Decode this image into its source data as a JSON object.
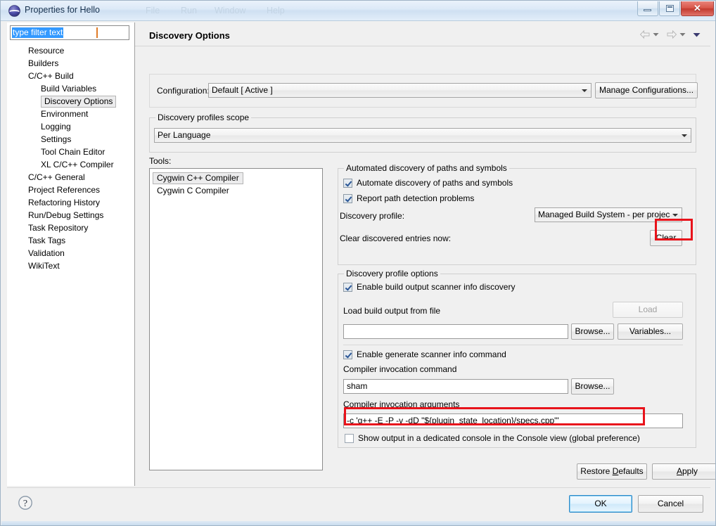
{
  "window": {
    "title": "Properties for Hello",
    "icon": "eclipse-sphere-icon",
    "ghost_menu": [
      "...",
      "...",
      "...",
      "..."
    ],
    "controls": {
      "minimize": "minimize-icon",
      "restore": "restore-icon",
      "close": "✕"
    }
  },
  "sidebar": {
    "filter": {
      "value": "type filter text",
      "placeholder": "type filter text",
      "selected": true
    },
    "items": [
      {
        "label": "Resource",
        "level": 0,
        "selected": false
      },
      {
        "label": "Builders",
        "level": 0,
        "selected": false
      },
      {
        "label": "C/C++ Build",
        "level": 0,
        "selected": false
      },
      {
        "label": "Build Variables",
        "level": 1,
        "selected": false
      },
      {
        "label": "Discovery Options",
        "level": 1,
        "selected": true
      },
      {
        "label": "Environment",
        "level": 1,
        "selected": false
      },
      {
        "label": "Logging",
        "level": 1,
        "selected": false
      },
      {
        "label": "Settings",
        "level": 1,
        "selected": false
      },
      {
        "label": "Tool Chain Editor",
        "level": 1,
        "selected": false
      },
      {
        "label": "XL C/C++ Compiler",
        "level": 1,
        "selected": false
      },
      {
        "label": "C/C++ General",
        "level": 0,
        "selected": false
      },
      {
        "label": "Project References",
        "level": 0,
        "selected": false
      },
      {
        "label": "Refactoring History",
        "level": 0,
        "selected": false
      },
      {
        "label": "Run/Debug Settings",
        "level": 0,
        "selected": false
      },
      {
        "label": "Task Repository",
        "level": 0,
        "selected": false
      },
      {
        "label": "Task Tags",
        "level": 0,
        "selected": false
      },
      {
        "label": "Validation",
        "level": 0,
        "selected": false
      },
      {
        "label": "WikiText",
        "level": 0,
        "selected": false
      }
    ]
  },
  "page": {
    "title": "Discovery Options",
    "nav": {
      "back": "back-arrow-icon",
      "back_menu": "chevron-down-icon",
      "forward": "forward-arrow-icon",
      "forward_menu": "chevron-down-icon",
      "view_menu": "chevron-down-icon"
    },
    "configuration": {
      "label": "Configuration:",
      "value": "Default  [ Active ]",
      "manage_button": "Manage Configurations..."
    },
    "scope_group": {
      "title": "Discovery profiles scope",
      "value": "Per Language"
    },
    "tools": {
      "label": "Tools:",
      "items": [
        {
          "label": "Cygwin C++ Compiler",
          "selected": true
        },
        {
          "label": "Cygwin C Compiler",
          "selected": false
        }
      ]
    },
    "automated_group": {
      "title": "Automated discovery of paths and symbols",
      "automate_checkbox": {
        "label": "Automate discovery of paths and symbols",
        "checked": true
      },
      "report_checkbox": {
        "label": "Report path detection problems",
        "checked": true
      },
      "profile_label": "Discovery profile:",
      "profile_value": "Managed Build System - per projec",
      "clear_label": "Clear discovered entries now:",
      "clear_button": "Clear"
    },
    "profile_options_group": {
      "title": "Discovery profile options",
      "enable_build_output": {
        "label": "Enable build output scanner info discovery",
        "checked": true
      },
      "load_file_label": "Load build output from file",
      "load_button": "Load",
      "load_button_disabled": true,
      "load_file_value": "",
      "browse_file_button": "Browse...",
      "variables_button": "Variables...",
      "enable_generate": {
        "label": "Enable generate scanner info command",
        "checked": true
      },
      "invocation_command_label": "Compiler invocation command",
      "invocation_command_value": "sham",
      "browse_command_button": "Browse...",
      "invocation_args_label": "Compiler invocation arguments",
      "invocation_args_value": "-c 'g++ -E -P -v -dD \"${plugin_state_location}/specs.cpp\"'",
      "show_console": {
        "label": "Show output in a dedicated console in the Console view (global preference)",
        "checked": false
      }
    },
    "restore_defaults_button": "Restore Defaults",
    "apply_button": "Apply"
  },
  "footer": {
    "help_icon": "help-question-icon",
    "ok_button": "OK",
    "cancel_button": "Cancel"
  },
  "annotations": {
    "accent_color": "#e8131b",
    "targets": [
      "clear-button",
      "show-output-console-checkbox"
    ]
  }
}
